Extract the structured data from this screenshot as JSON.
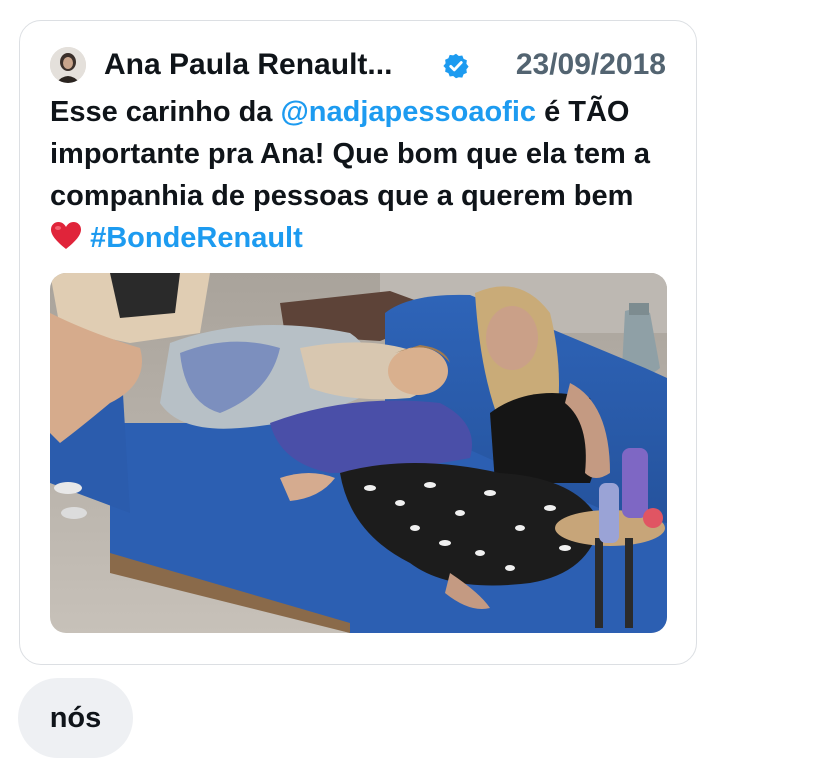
{
  "tweet": {
    "author_name": "Ana Paula Renault...",
    "date": "23/09/2018",
    "verified": true,
    "text_parts": {
      "p1": "Esse carinho da ",
      "mention": "@nadjapessoaofic",
      "p2": " é TÃO importante pra Ana! Que bom que ela tem a companhia de pessoas que a querem bem ",
      "p3": " ",
      "hashtag": "#BondeRenault"
    },
    "media_icon": "photo",
    "heart_icon": "red-heart-icon"
  },
  "reply": {
    "text": "nós"
  },
  "colors": {
    "link": "#1d9bf0",
    "text": "#0f1419",
    "muted": "#536471",
    "bubble": "#eef0f3",
    "border": "#dcdfe3"
  }
}
